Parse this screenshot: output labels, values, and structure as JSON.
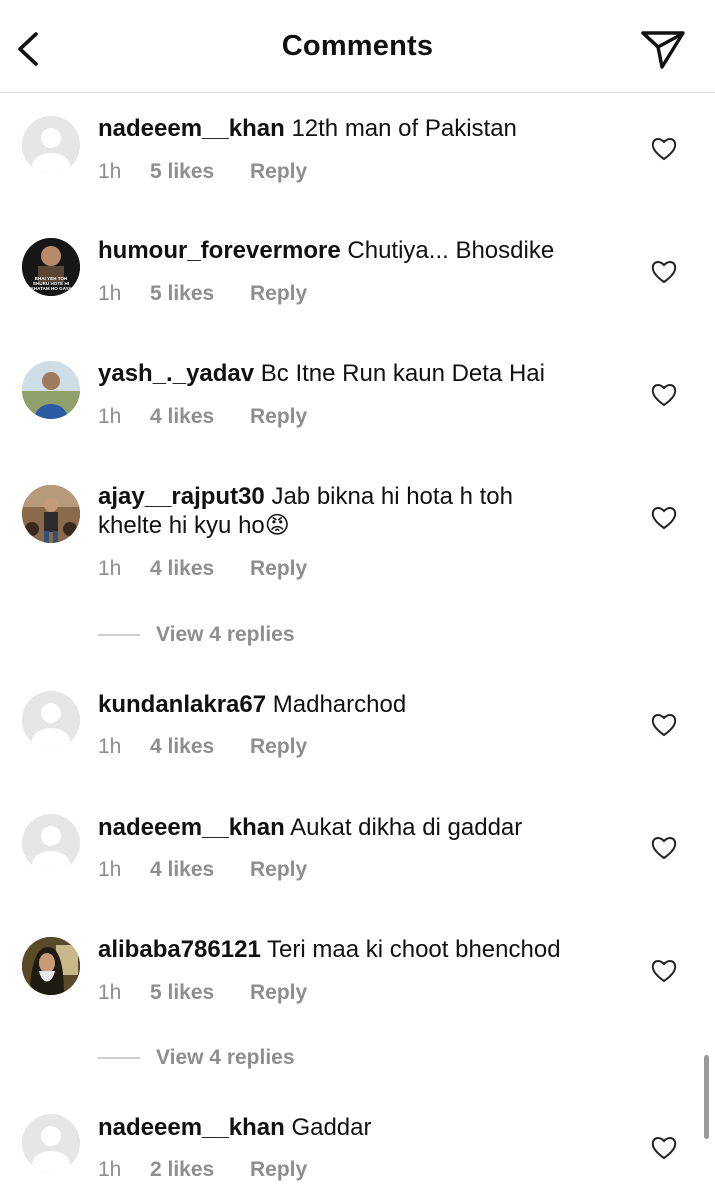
{
  "header": {
    "title": "Comments",
    "back_icon": "chevron-left-icon",
    "share_icon": "paper-plane-icon"
  },
  "comments": [
    {
      "username": "nadeeem__khan",
      "text": "12th man of Pakistan",
      "time": "1h",
      "likes": "5 likes",
      "reply": "Reply"
    },
    {
      "username": "humour_forevermore",
      "text": "Chutiya... Bhosdike",
      "time": "1h",
      "likes": "5 likes",
      "reply": "Reply",
      "avatar_text": "BHAI YEH TOH SHURU HOTE HI KHATAM HO GAYA"
    },
    {
      "username": "yash_._yadav",
      "text": "Bc Itne Run kaun Deta Hai",
      "time": "1h",
      "likes": "4 likes",
      "reply": "Reply"
    },
    {
      "username": "ajay__rajput30",
      "text_line1": "Jab bikna hi hota h toh",
      "text_line2": "khelte hi kyu ho",
      "emoji": "😡",
      "time": "1h",
      "likes": "4 likes",
      "reply": "Reply",
      "view_replies": "View 4 replies"
    },
    {
      "username": "kundanlakra67",
      "text": "Madharchod",
      "time": "1h",
      "likes": "4 likes",
      "reply": "Reply"
    },
    {
      "username": "nadeeem__khan",
      "text": "Aukat dikha di gaddar",
      "time": "1h",
      "likes": "4 likes",
      "reply": "Reply"
    },
    {
      "username": "alibaba786121",
      "text": "Teri maa ki choot bhenchod",
      "time": "1h",
      "likes": "5 likes",
      "reply": "Reply",
      "view_replies": "View 4 replies"
    },
    {
      "username": "nadeeem__khan",
      "text": "Gaddar",
      "time": "1h",
      "likes": "2 likes",
      "reply": "Reply"
    }
  ],
  "colors": {
    "text": "#111111",
    "meta": "#8e8e8e",
    "divider": "#dedede"
  }
}
